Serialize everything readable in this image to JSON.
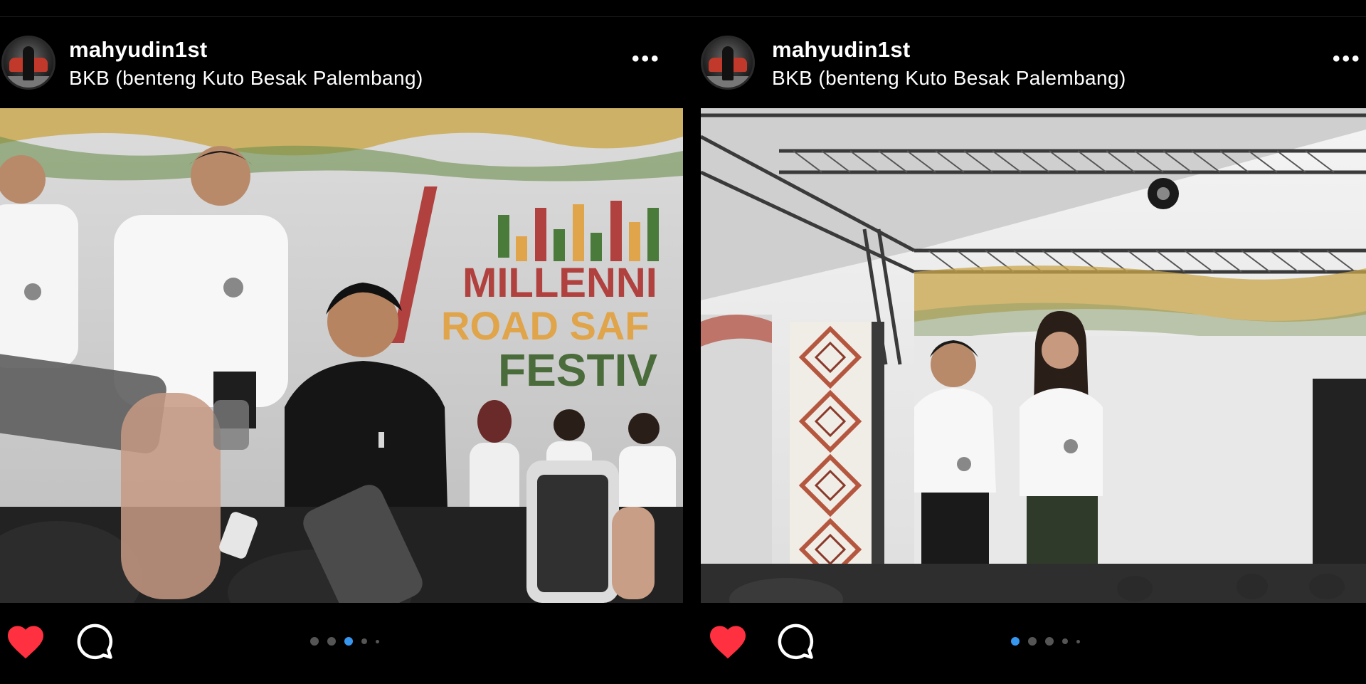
{
  "posts": [
    {
      "username": "mahyudin1st",
      "location": "BKB (benteng Kuto Besak Palembang)",
      "more_label": "•••",
      "banner": {
        "line1": "MILLENNI",
        "line2": "ROAD SAF",
        "line3": "FESTIV"
      },
      "liked": true,
      "carousel_count": 5,
      "carousel_active": 3
    },
    {
      "username": "mahyudin1st",
      "location": "BKB (benteng Kuto Besak Palembang)",
      "more_label": "•••",
      "liked": true,
      "carousel_count": 5,
      "carousel_active": 1
    }
  ],
  "colors": {
    "like": "#ff3040",
    "carousel_active": "#3797f0",
    "background": "#000000"
  },
  "icons": [
    "heart-icon",
    "comment-icon",
    "more-icon"
  ]
}
